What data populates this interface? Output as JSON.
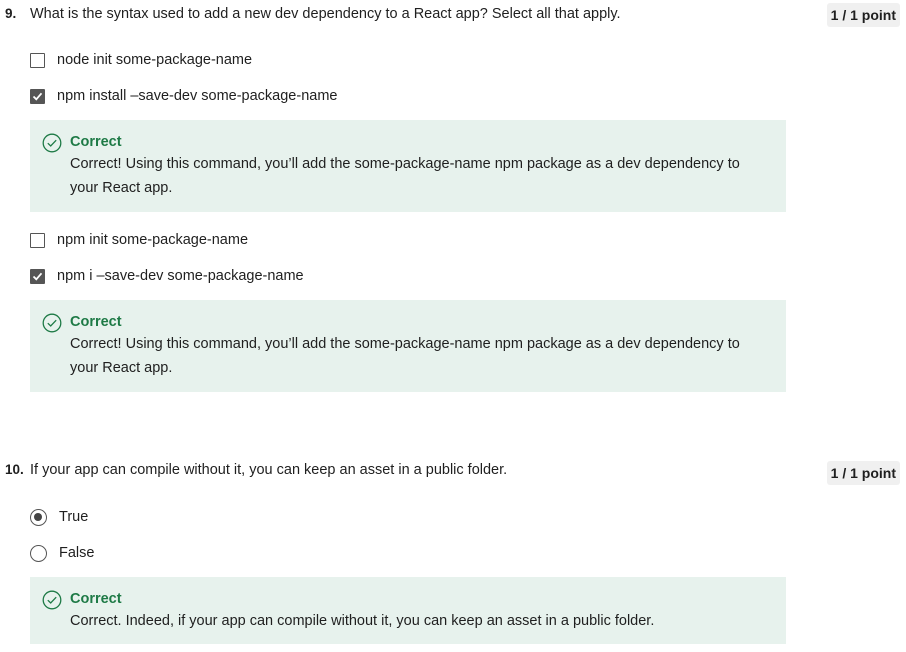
{
  "questions": [
    {
      "number": "9.",
      "text": "What is the syntax used to add a new dev dependency to a React app? Select all that apply.",
      "score": "1 / 1 point",
      "options": [
        {
          "label": "node init some-package-name",
          "checked": false
        },
        {
          "label": "npm install –save-dev some-package-name",
          "checked": true,
          "feedback": {
            "title": "Correct",
            "body": "Correct! Using this command, you’ll add the some-package-name npm package as a dev dependency to your React app."
          }
        },
        {
          "label": "npm init some-package-name",
          "checked": false
        },
        {
          "label": "npm i –save-dev some-package-name",
          "checked": true,
          "feedback": {
            "title": "Correct",
            "body": "Correct! Using this command, you’ll add the some-package-name npm package as a dev dependency to your React app."
          }
        }
      ]
    },
    {
      "number": "10.",
      "text": "If your app can compile without it, you can keep an asset in a public folder.",
      "score": "1 / 1 point",
      "options": [
        {
          "label": "True",
          "selected": true
        },
        {
          "label": "False",
          "selected": false
        }
      ],
      "feedback": {
        "title": "Correct",
        "body": "Correct. Indeed, if your app can compile without it, you can keep an asset in a public folder."
      }
    }
  ],
  "colors": {
    "correct_green": "#1e7a46",
    "feedback_bg": "#e7f2ed",
    "score_bg": "#f0f0f0"
  }
}
